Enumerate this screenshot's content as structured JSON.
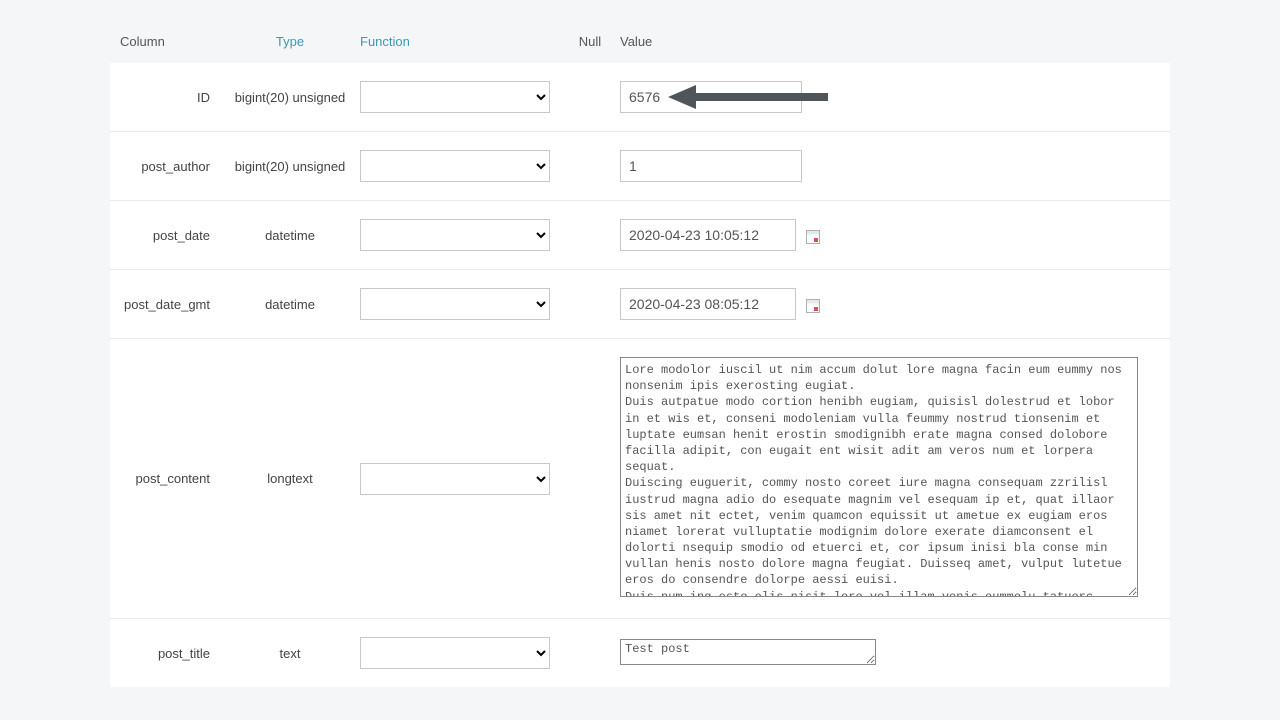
{
  "headers": {
    "column": "Column",
    "type": "Type",
    "function": "Function",
    "null": "Null",
    "value": "Value"
  },
  "rows": [
    {
      "column": "ID",
      "type": "bigint(20) unsigned",
      "value": "6576",
      "kind": "text",
      "hasArrow": true
    },
    {
      "column": "post_author",
      "type": "bigint(20) unsigned",
      "value": "1",
      "kind": "text"
    },
    {
      "column": "post_date",
      "type": "datetime",
      "value": "2020-04-23 10:05:12",
      "kind": "date"
    },
    {
      "column": "post_date_gmt",
      "type": "datetime",
      "value": "2020-04-23 08:05:12",
      "kind": "date"
    },
    {
      "column": "post_content",
      "type": "longtext",
      "value": "Lore modolor iuscil ut nim accum dolut lore magna facin eum eummy nos nonsenim ipis exerosting eugiat.\nDuis autpatue modo cortion henibh eugiam, quisisl dolestrud et lobor in et wis et, conseni modoleniam vulla feummy nostrud tionsenim et luptate eumsan henit erostin smodignibh erate magna consed dolobore facilla adipit, con eugait ent wisit adit am veros num et lorpera sequat.\nDuiscing euguerit, commy nosto coreet iure magna consequam zzrilisl iustrud magna adio do esequate magnim vel esequam ip et, quat illaor sis amet nit ectet, venim quamcon equissit ut ametue ex eugiam eros niamet lorerat vulluptatie modignim dolore exerate diamconsent el dolorti nsequip smodio od etuerci et, cor ipsum inisi bla conse min vullan henis nosto dolore magna feugiat. Duisseq amet, vulput lutetue eros do consendre dolorpe aessi euisi.\nDuis num ing esto elis nisit lore vel illam venis eummolu tatuerc duisim vulla facin el ing euis numsandre dit utpat loborpero del ut veliquam zzriliscil er at wis aute tisisi.\nLore dunt lut lore feu feu facilis nissequat la facipisisit prat.",
      "kind": "bigtext"
    },
    {
      "column": "post_title",
      "type": "text",
      "value": "Test post",
      "kind": "smalltext"
    }
  ]
}
